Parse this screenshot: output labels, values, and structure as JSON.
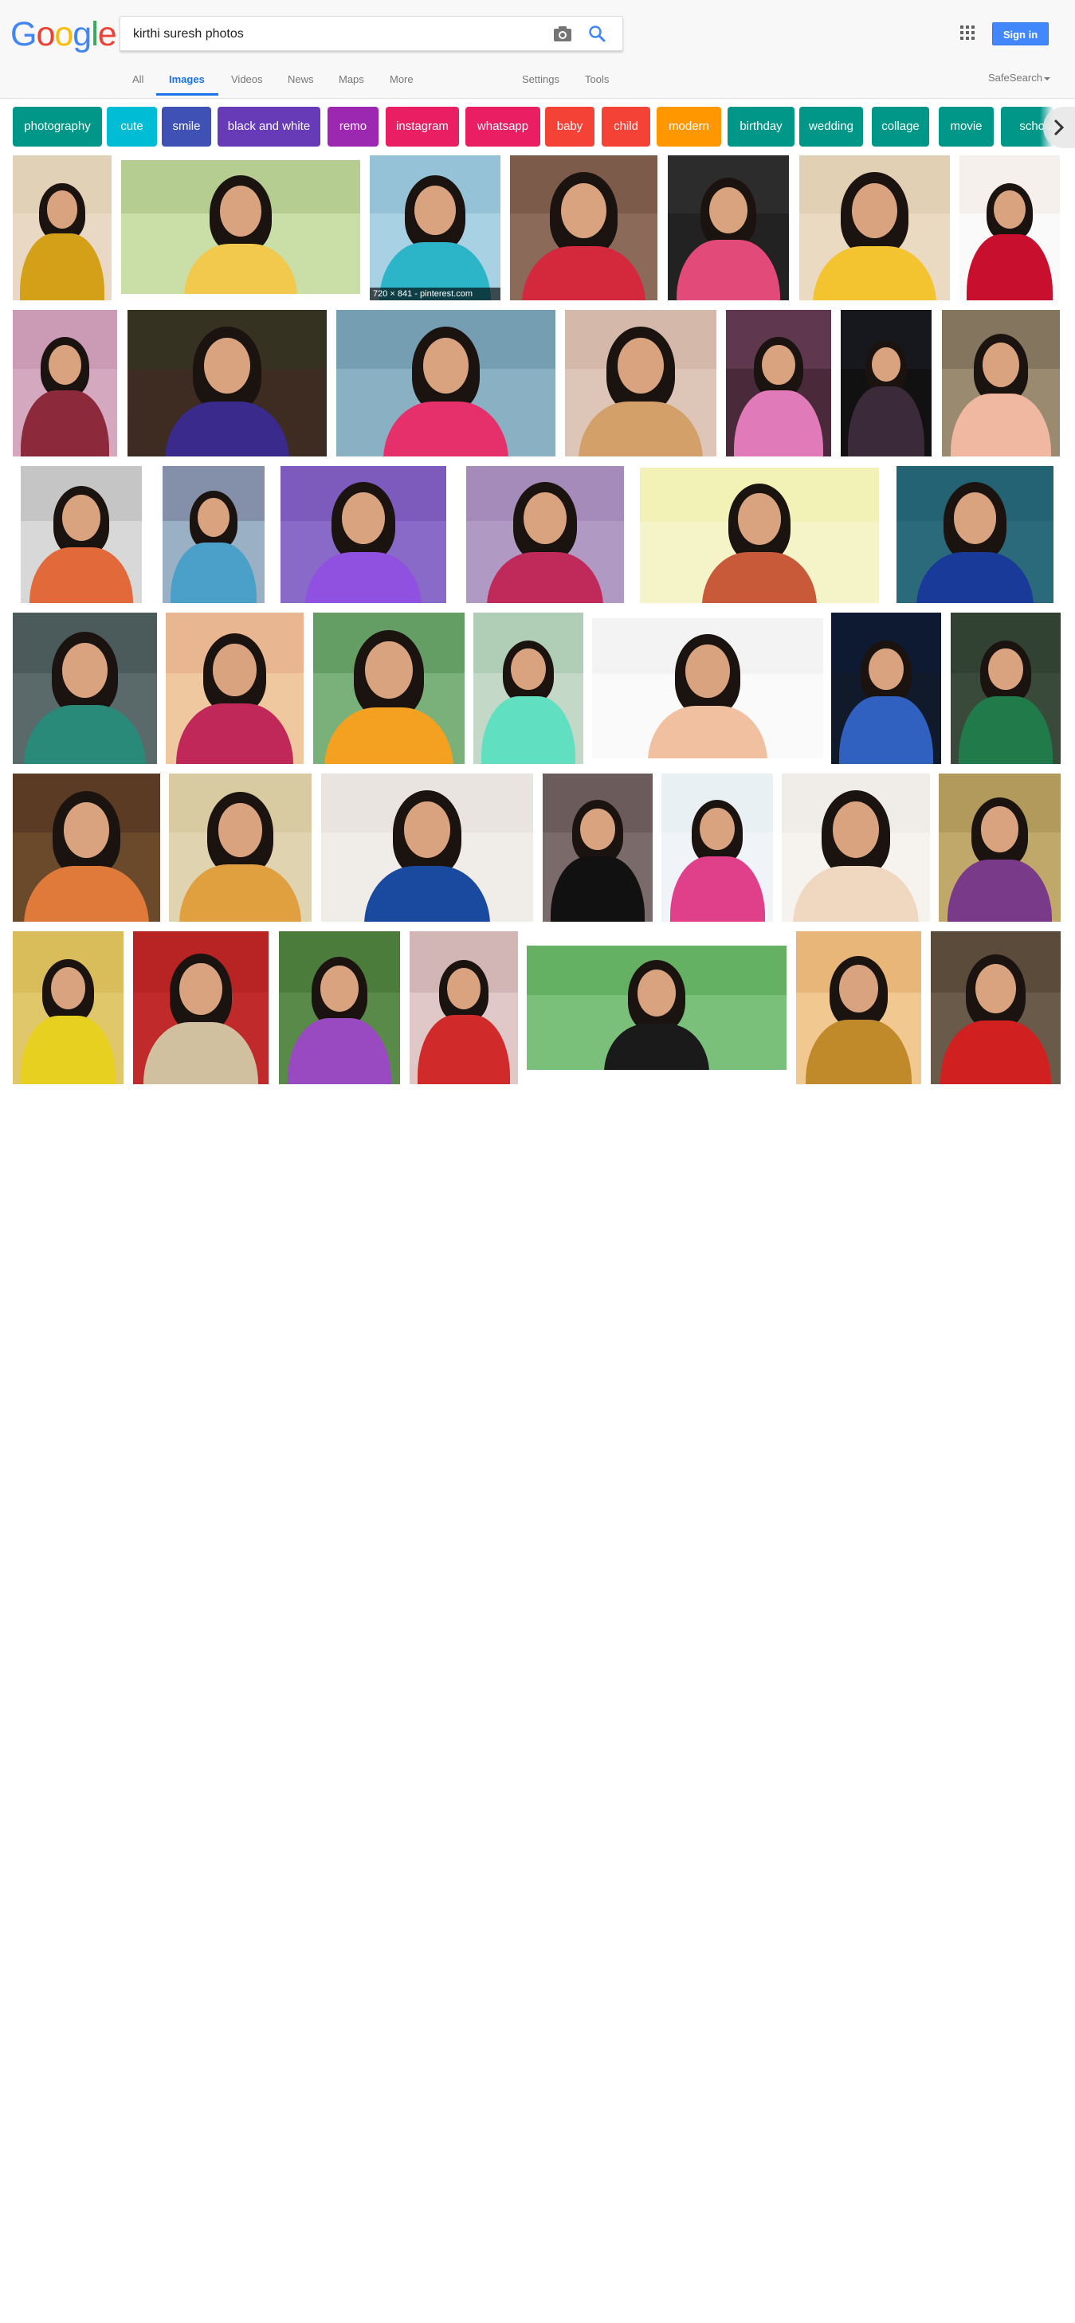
{
  "header": {
    "logo_letters": [
      {
        "ch": "G",
        "color": "#4285f4"
      },
      {
        "ch": "o",
        "color": "#ea4335"
      },
      {
        "ch": "o",
        "color": "#fbbc05"
      },
      {
        "ch": "g",
        "color": "#4285f4"
      },
      {
        "ch": "l",
        "color": "#34a853"
      },
      {
        "ch": "e",
        "color": "#ea4335"
      }
    ],
    "search_value": "kirthi suresh photos",
    "signin_label": "Sign in"
  },
  "tabs": [
    {
      "label": "All",
      "active": false
    },
    {
      "label": "Images",
      "active": true
    },
    {
      "label": "Videos",
      "active": false
    },
    {
      "label": "News",
      "active": false
    },
    {
      "label": "Maps",
      "active": false
    },
    {
      "label": "More",
      "active": false
    },
    {
      "label": "Settings",
      "active": false
    },
    {
      "label": "Tools",
      "active": false
    }
  ],
  "safesearch_label": "SafeSearch",
  "chips": [
    {
      "label": "photography",
      "color": "#009688"
    },
    {
      "label": "cute",
      "color": "#00bcd4"
    },
    {
      "label": "smile",
      "color": "#3f51b5"
    },
    {
      "label": "black and white",
      "color": "#673ab7"
    },
    {
      "label": "remo",
      "color": "#9c27b0"
    },
    {
      "label": "instagram",
      "color": "#e91e63"
    },
    {
      "label": "whatsapp",
      "color": "#e91e63"
    },
    {
      "label": "baby",
      "color": "#f44336"
    },
    {
      "label": "child",
      "color": "#f44336"
    },
    {
      "label": "modern",
      "color": "#ff9800"
    },
    {
      "label": "birthday",
      "color": "#009688"
    },
    {
      "label": "wedding",
      "color": "#009688"
    },
    {
      "label": "collage",
      "color": "#009688"
    },
    {
      "label": "movie",
      "color": "#009688"
    },
    {
      "label": "school",
      "color": "#009688"
    }
  ],
  "image_caption": "720 × 841 - pinterest.com",
  "palette": {
    "accent": "#1a73e8",
    "signin": "#4387fd"
  }
}
